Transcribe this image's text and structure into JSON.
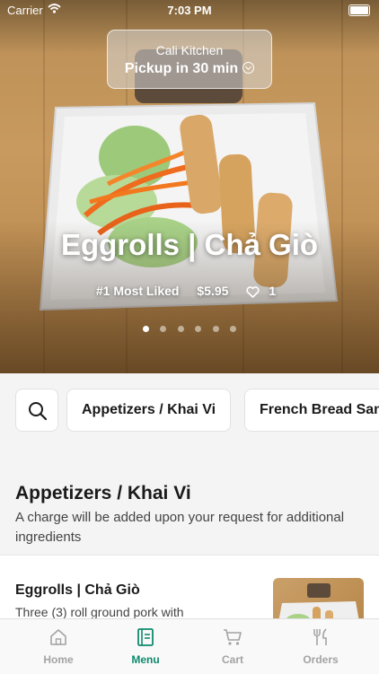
{
  "status_bar": {
    "carrier": "Carrier",
    "time": "7:03 PM"
  },
  "store": {
    "name": "Cali Kitchen",
    "pickup": "Pickup in 30 min"
  },
  "hero": {
    "title": "Eggrolls | Chả Giò",
    "rank": "#1 Most Liked",
    "price": "$5.95",
    "likes": "1",
    "slides_total": 6,
    "active_slide": 1
  },
  "categories": [
    {
      "label": "Appetizers / Khai Vi"
    },
    {
      "label": "French Bread Sandwiches"
    }
  ],
  "section": {
    "title": "Appetizers / Khai Vi",
    "description": "A charge will be added upon your request for additional ingredients"
  },
  "items": [
    {
      "title": "Eggrolls | Chả Giò",
      "description": "Three (3) roll ground pork with"
    }
  ],
  "tabs": [
    {
      "label": "Home",
      "icon": "home-icon"
    },
    {
      "label": "Menu",
      "icon": "menu-icon"
    },
    {
      "label": "Cart",
      "icon": "cart-icon"
    },
    {
      "label": "Orders",
      "icon": "utensils-icon"
    }
  ],
  "colors": {
    "accent": "#0f8a6e",
    "inactive_tab": "#a3a3a3",
    "background": "#f4f4f4"
  }
}
